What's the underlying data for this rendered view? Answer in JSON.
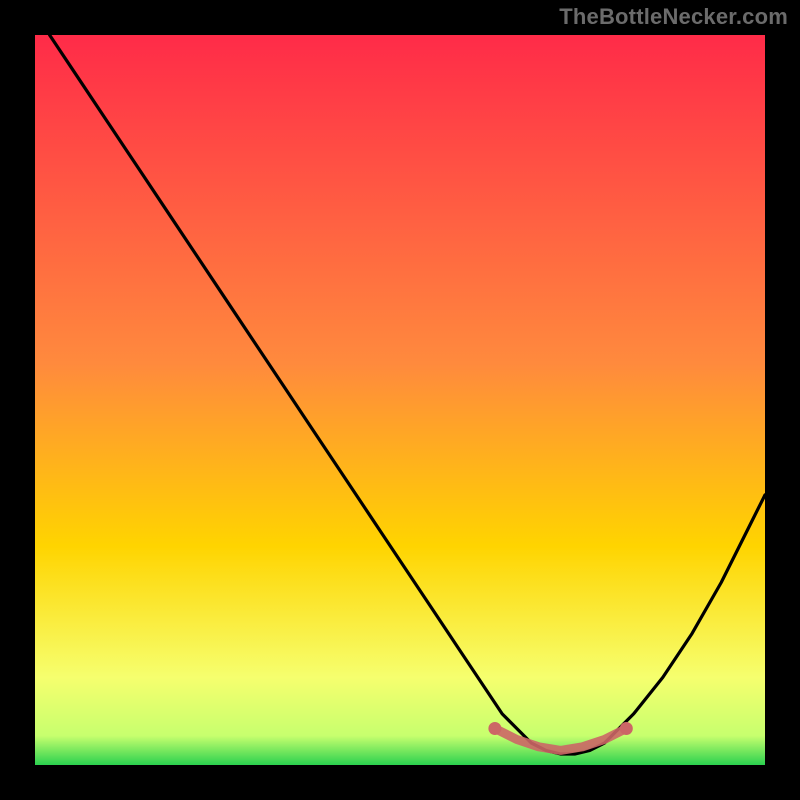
{
  "watermark": "TheBottleNecker.com",
  "colors": {
    "frame": "#000000",
    "gradient_top": "#ff2b48",
    "gradient_mid": "#ffd400",
    "gradient_low": "#f6ff6e",
    "gradient_bottom": "#2bd14f",
    "curve": "#000000",
    "marker": "#cc6666"
  },
  "chart_data": {
    "type": "line",
    "title": "",
    "xlabel": "",
    "ylabel": "",
    "xlim": [
      0,
      100
    ],
    "ylim": [
      0,
      100
    ],
    "series": [
      {
        "name": "bottleneck-curve",
        "x": [
          2,
          6,
          10,
          14,
          18,
          22,
          26,
          30,
          34,
          38,
          42,
          46,
          50,
          54,
          58,
          62,
          64,
          66,
          68,
          70,
          72,
          74,
          76,
          78,
          80,
          82,
          86,
          90,
          94,
          98,
          100
        ],
        "y": [
          100,
          94,
          88,
          82,
          76,
          70,
          64,
          58,
          52,
          46,
          40,
          34,
          28,
          22,
          16,
          10,
          7,
          5,
          3,
          2,
          1.5,
          1.5,
          2,
          3,
          5,
          7,
          12,
          18,
          25,
          33,
          37
        ]
      }
    ],
    "markers": {
      "name": "optimal-range",
      "x": [
        63,
        66,
        69,
        72,
        75,
        78,
        81
      ],
      "y": [
        5,
        3.5,
        2.5,
        2,
        2.5,
        3.5,
        5
      ]
    }
  }
}
